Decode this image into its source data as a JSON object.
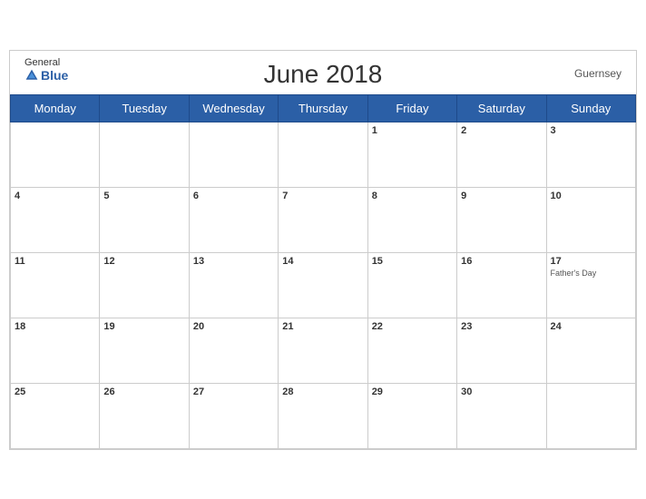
{
  "header": {
    "title": "June 2018",
    "country": "Guernsey",
    "logo_general": "General",
    "logo_blue": "Blue"
  },
  "weekdays": [
    "Monday",
    "Tuesday",
    "Wednesday",
    "Thursday",
    "Friday",
    "Saturday",
    "Sunday"
  ],
  "weeks": [
    [
      {
        "day": "",
        "event": ""
      },
      {
        "day": "",
        "event": ""
      },
      {
        "day": "",
        "event": ""
      },
      {
        "day": "",
        "event": ""
      },
      {
        "day": "1",
        "event": ""
      },
      {
        "day": "2",
        "event": ""
      },
      {
        "day": "3",
        "event": ""
      }
    ],
    [
      {
        "day": "4",
        "event": ""
      },
      {
        "day": "5",
        "event": ""
      },
      {
        "day": "6",
        "event": ""
      },
      {
        "day": "7",
        "event": ""
      },
      {
        "day": "8",
        "event": ""
      },
      {
        "day": "9",
        "event": ""
      },
      {
        "day": "10",
        "event": ""
      }
    ],
    [
      {
        "day": "11",
        "event": ""
      },
      {
        "day": "12",
        "event": ""
      },
      {
        "day": "13",
        "event": ""
      },
      {
        "day": "14",
        "event": ""
      },
      {
        "day": "15",
        "event": ""
      },
      {
        "day": "16",
        "event": ""
      },
      {
        "day": "17",
        "event": "Father's Day"
      }
    ],
    [
      {
        "day": "18",
        "event": ""
      },
      {
        "day": "19",
        "event": ""
      },
      {
        "day": "20",
        "event": ""
      },
      {
        "day": "21",
        "event": ""
      },
      {
        "day": "22",
        "event": ""
      },
      {
        "day": "23",
        "event": ""
      },
      {
        "day": "24",
        "event": ""
      }
    ],
    [
      {
        "day": "25",
        "event": ""
      },
      {
        "day": "26",
        "event": ""
      },
      {
        "day": "27",
        "event": ""
      },
      {
        "day": "28",
        "event": ""
      },
      {
        "day": "29",
        "event": ""
      },
      {
        "day": "30",
        "event": ""
      },
      {
        "day": "",
        "event": ""
      }
    ]
  ],
  "colors": {
    "header_bg": "#2b5fa6",
    "header_text": "#ffffff",
    "title_color": "#333333",
    "border": "#cccccc"
  }
}
